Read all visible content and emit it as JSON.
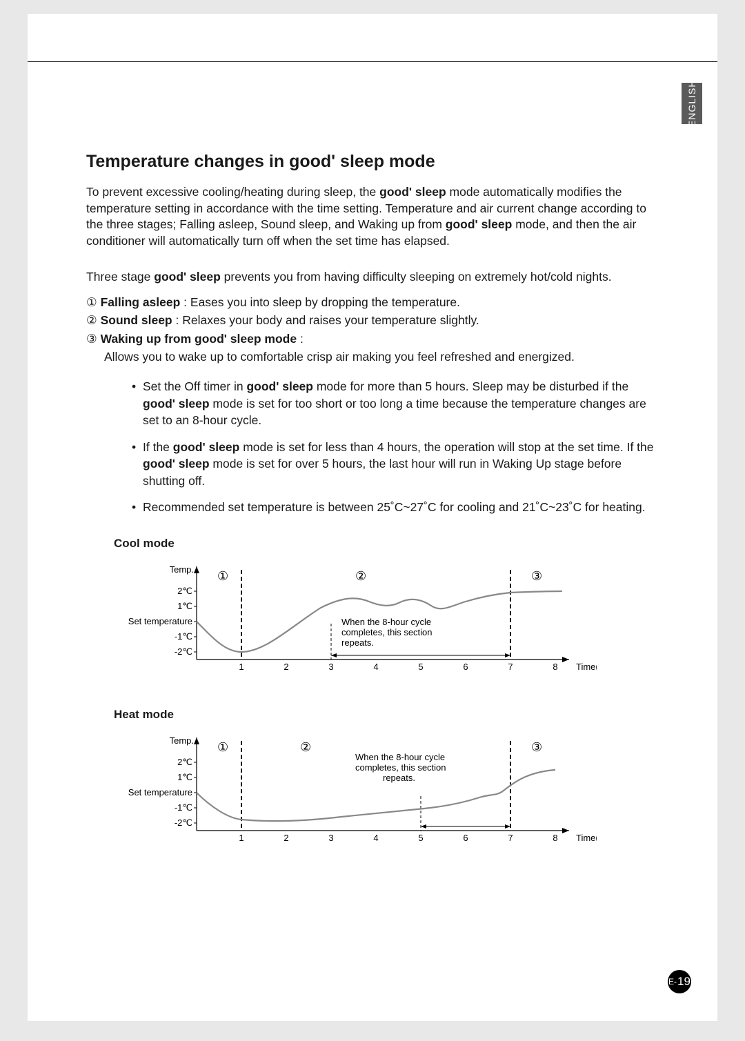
{
  "language_tab": "ENGLISH",
  "heading": {
    "pre": "Temperature changes in ",
    "brand": "good' sleep",
    "post": " mode"
  },
  "intro": {
    "pre": "To prevent excessive cooling/heating during sleep, the ",
    "brand1": "good' sleep",
    "mid": " mode automatically modifies the temperature setting in accordance with the time setting. Temperature and air current change according to the three stages; Falling asleep, Sound sleep, and Waking up from ",
    "brand2": "good' sleep",
    "post": " mode, and then the air conditioner will automatically turn off when the set time has elapsed."
  },
  "subhead": {
    "pre": "Three stage ",
    "brand": "good' sleep",
    "post": " prevents you from having difficulty sleeping on extremely hot/cold nights."
  },
  "stages": {
    "s1": {
      "num": "①",
      "label": "Falling asleep",
      "text": " : Eases you into sleep by dropping the temperature."
    },
    "s2": {
      "num": "②",
      "label": "Sound sleep",
      "text": " : Relaxes your body and raises your temperature slightly."
    },
    "s3": {
      "num": "③",
      "label_pre": "Waking up from ",
      "brand": "good' sleep",
      "label_post": " mode",
      "colon": " :",
      "detail": "Allows you to wake up to comfortable crisp air making you feel refreshed and energized."
    }
  },
  "bullets": {
    "b1": {
      "pre": "Set the Off timer in ",
      "brand1": "good' sleep",
      "mid": " mode for more than 5 hours. Sleep may be disturbed if the ",
      "brand2": "good' sleep",
      "post": " mode is set for too short or too long a time because the temperature changes are set to an 8-hour cycle."
    },
    "b2": {
      "pre": "If the ",
      "brand1": "good' sleep",
      "mid": " mode is set for less than 4 hours, the operation will stop at the set time. If the ",
      "brand2": "good' sleep",
      "post": " mode is set for over 5 hours, the last hour will run in Waking Up stage before shutting off."
    },
    "b3": "Recommended set temperature is between 25˚C~27˚C for cooling and 21˚C~23˚C for heating."
  },
  "axis": {
    "ylabel": "Temp.",
    "xlabel": "Time(hr.)",
    "yticks": [
      "2℃",
      "1℃",
      "Set temperature",
      "-1℃",
      "-2℃"
    ],
    "xticks": [
      "1",
      "2",
      "3",
      "4",
      "5",
      "6",
      "7",
      "8"
    ],
    "note": "When the 8-hour cycle completes, this section repeats.",
    "markers": {
      "m1": "①",
      "m2": "②",
      "m3": "③"
    }
  },
  "charts": {
    "cool_title": "Cool mode",
    "heat_title": "Heat mode"
  },
  "page_number": {
    "prefix": "E-",
    "num": "19"
  },
  "chart_data": [
    {
      "type": "line",
      "title": "Cool mode",
      "xlabel": "Time(hr.)",
      "ylabel": "Temp.",
      "ylim": [
        -2,
        2
      ],
      "xlim": [
        0,
        8
      ],
      "x": [
        0.0,
        0.5,
        1.0,
        1.5,
        2.0,
        2.5,
        3.0,
        3.5,
        4.0,
        4.5,
        5.0,
        5.5,
        6.0,
        6.5,
        7.0,
        7.5,
        8.0
      ],
      "values": [
        0.0,
        -1.5,
        -2.0,
        -1.5,
        -0.5,
        0.5,
        1.2,
        1.6,
        1.3,
        1.0,
        1.4,
        1.0,
        1.3,
        1.6,
        1.8,
        1.9,
        2.0
      ],
      "stage_boundaries_hr": [
        1,
        7
      ],
      "repeat_section_hr": [
        3,
        7
      ],
      "annotations": [
        "When the 8-hour cycle completes, this section repeats."
      ]
    },
    {
      "type": "line",
      "title": "Heat mode",
      "xlabel": "Time(hr.)",
      "ylabel": "Temp.",
      "ylim": [
        -2,
        2
      ],
      "xlim": [
        0,
        8
      ],
      "x": [
        0.0,
        0.5,
        1.0,
        1.5,
        2.0,
        2.5,
        3.0,
        3.5,
        4.0,
        4.5,
        5.0,
        5.5,
        6.0,
        6.5,
        7.0,
        7.5,
        8.0
      ],
      "values": [
        0.0,
        -1.3,
        -1.8,
        -1.9,
        -1.9,
        -1.8,
        -1.6,
        -1.4,
        -1.2,
        -1.1,
        -1.0,
        -0.9,
        -0.7,
        -0.3,
        0.2,
        1.0,
        1.5
      ],
      "stage_boundaries_hr": [
        1,
        7
      ],
      "repeat_section_hr": [
        5,
        7
      ],
      "annotations": [
        "When the 8-hour cycle completes, this section repeats."
      ]
    }
  ]
}
